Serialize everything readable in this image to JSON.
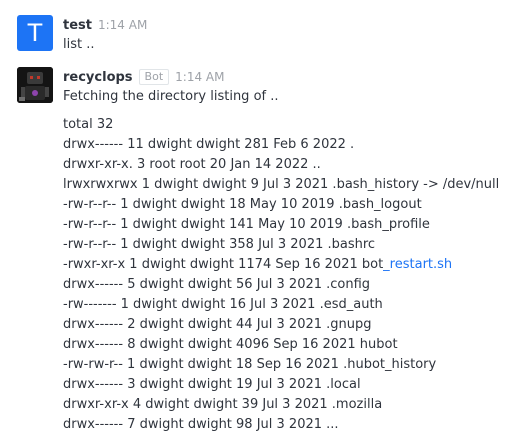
{
  "messages": [
    {
      "avatar_letter": "T",
      "user": "test",
      "time": "1:14 AM",
      "text": "list .."
    },
    {
      "user": "recyclops",
      "bot_tag": "Bot",
      "time": "1:14 AM",
      "text": "Fetching the directory listing of ..",
      "listing": [
        {
          "text": "total 32"
        },
        {
          "text": "drwx------ 11 dwight dwight 281 Feb 6 2022 ."
        },
        {
          "text": "drwxr-xr-x. 3 root root 20 Jan 14 2022 .."
        },
        {
          "text": "lrwxrwxrwx 1 dwight dwight 9 Jul 3 2021 .bash_history -> /dev/null"
        },
        {
          "text": "-rw-r--r-- 1 dwight dwight 18 May 10 2019 .bash_logout"
        },
        {
          "text": "-rw-r--r-- 1 dwight dwight 141 May 10 2019 .bash_profile"
        },
        {
          "text": "-rw-r--r-- 1 dwight dwight 358 Jul 3 2021 .bashrc"
        },
        {
          "text": "-rwxr-xr-x 1 dwight dwight 1174 Sep 16 2021 bot",
          "link": "_restart.sh"
        },
        {
          "text": "drwx------ 5 dwight dwight 56 Jul 3 2021 .config"
        },
        {
          "text": "-rw------- 1 dwight dwight 16 Jul 3 2021 .esd_auth"
        },
        {
          "text": "drwx------ 2 dwight dwight 44 Jul 3 2021 .gnupg"
        },
        {
          "text": "drwx------ 8 dwight dwight 4096 Sep 16 2021 hubot"
        },
        {
          "text": "-rw-rw-r-- 1 dwight dwight 18 Sep 16 2021 .hubot_history"
        },
        {
          "text": "drwx------ 3 dwight dwight 19 Jul 3 2021 .local"
        },
        {
          "text": "drwxr-xr-x 4 dwight dwight 39 Jul 3 2021 .mozilla"
        },
        {
          "text": "drwx------ 7 dwight dwight 98 Jul 3 2021 ..."
        }
      ]
    }
  ]
}
